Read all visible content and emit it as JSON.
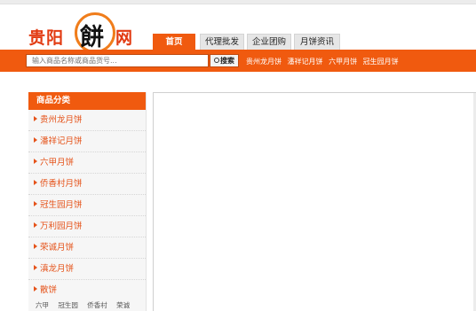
{
  "logo": {
    "part1": "贵阳",
    "part2": "餅",
    "part3": "网"
  },
  "nav": {
    "tabs": [
      "首页",
      "代理批发",
      "企业团购",
      "月饼资讯"
    ]
  },
  "search": {
    "placeholder": "输入商品名称或商品货号...",
    "button": "搜索"
  },
  "quick_links": [
    "贵州龙月饼",
    "潘祥记月饼",
    "六甲月饼",
    "冠生园月饼"
  ],
  "category": {
    "title": "商品分类",
    "items": [
      "贵州龙月饼",
      "潘祥记月饼",
      "六甲月饼",
      "侨香村月饼",
      "冠生园月饼",
      "万利园月饼",
      "荣诚月饼",
      "滇龙月饼",
      "散饼"
    ],
    "sub_items": [
      "六甲",
      "冠生园",
      "侨香村",
      "荣诚"
    ]
  }
}
